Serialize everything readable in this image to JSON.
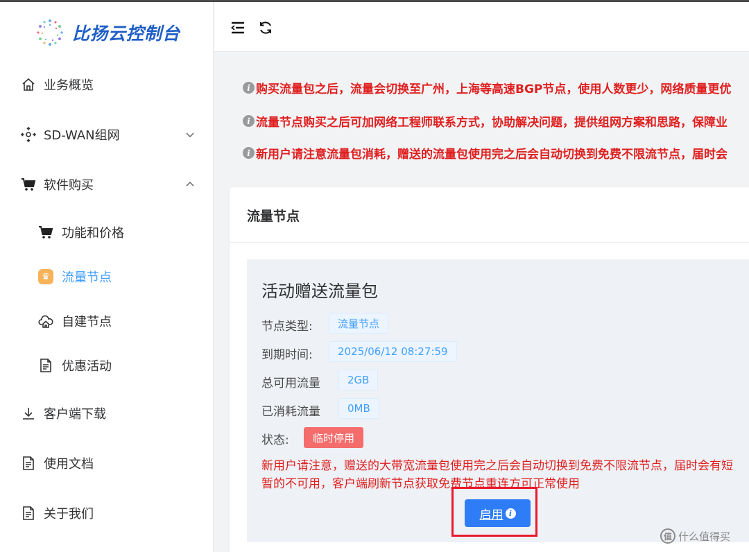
{
  "app": {
    "brand": "比扬云控制台"
  },
  "sidebar": {
    "items": [
      {
        "label": "业务概览",
        "icon": "home-icon"
      },
      {
        "label": "SD-WAN组网",
        "icon": "network-icon",
        "expanded": false
      },
      {
        "label": "软件购买",
        "icon": "cart-icon",
        "expanded": true
      },
      {
        "label": "客户端下载",
        "icon": "download-icon"
      },
      {
        "label": "使用文档",
        "icon": "document-icon"
      },
      {
        "label": "关于我们",
        "icon": "document-icon"
      }
    ],
    "sub_items": [
      {
        "label": "功能和价格",
        "icon": "cart-icon"
      },
      {
        "label": "流量节点",
        "icon": "crown-icon",
        "active": true
      },
      {
        "label": "自建节点",
        "icon": "cloud-home-icon"
      },
      {
        "label": "优惠活动",
        "icon": "document-icon"
      }
    ]
  },
  "topbar": {
    "icons": [
      "menu-collapse-icon",
      "refresh-icon"
    ]
  },
  "notices": [
    "购买流量包之后，流量会切换至广州，上海等高速BGP节点，使用人数更少，网络质量更优",
    "流量节点购买之后可加网络工程师联系方式，协助解决问题，提供组网方案和思路，保障业",
    "新用户请注意流量包消耗，赠送的流量包使用完之后会自动切换到免费不限流节点，届时会"
  ],
  "card": {
    "title": "流量节点",
    "package": {
      "name": "活动赠送流量包",
      "fields": [
        {
          "label": "节点类型:",
          "value": "流量节点"
        },
        {
          "label": "到期时间:",
          "value": "2025/06/12 08:27:59"
        },
        {
          "label": "总可用流量",
          "value": "2GB"
        },
        {
          "label": "已消耗流量",
          "value": "0MB"
        },
        {
          "label": "状态:",
          "value": "临时停用"
        }
      ],
      "warning": "新用户请注意，赠送的大带宽流量包使用完之后会自动切换到免费不限流节点，届时会有短暂的不可用，客户端刷新节点获取免费节点重连方可正常使用",
      "button_label": "启用"
    }
  },
  "watermark": "什么值得买",
  "colors": {
    "accent": "#409eff",
    "danger": "#e02020",
    "button": "#2f7df6",
    "brand": "#1f5fc9",
    "highlight_border": "#e8192c"
  }
}
